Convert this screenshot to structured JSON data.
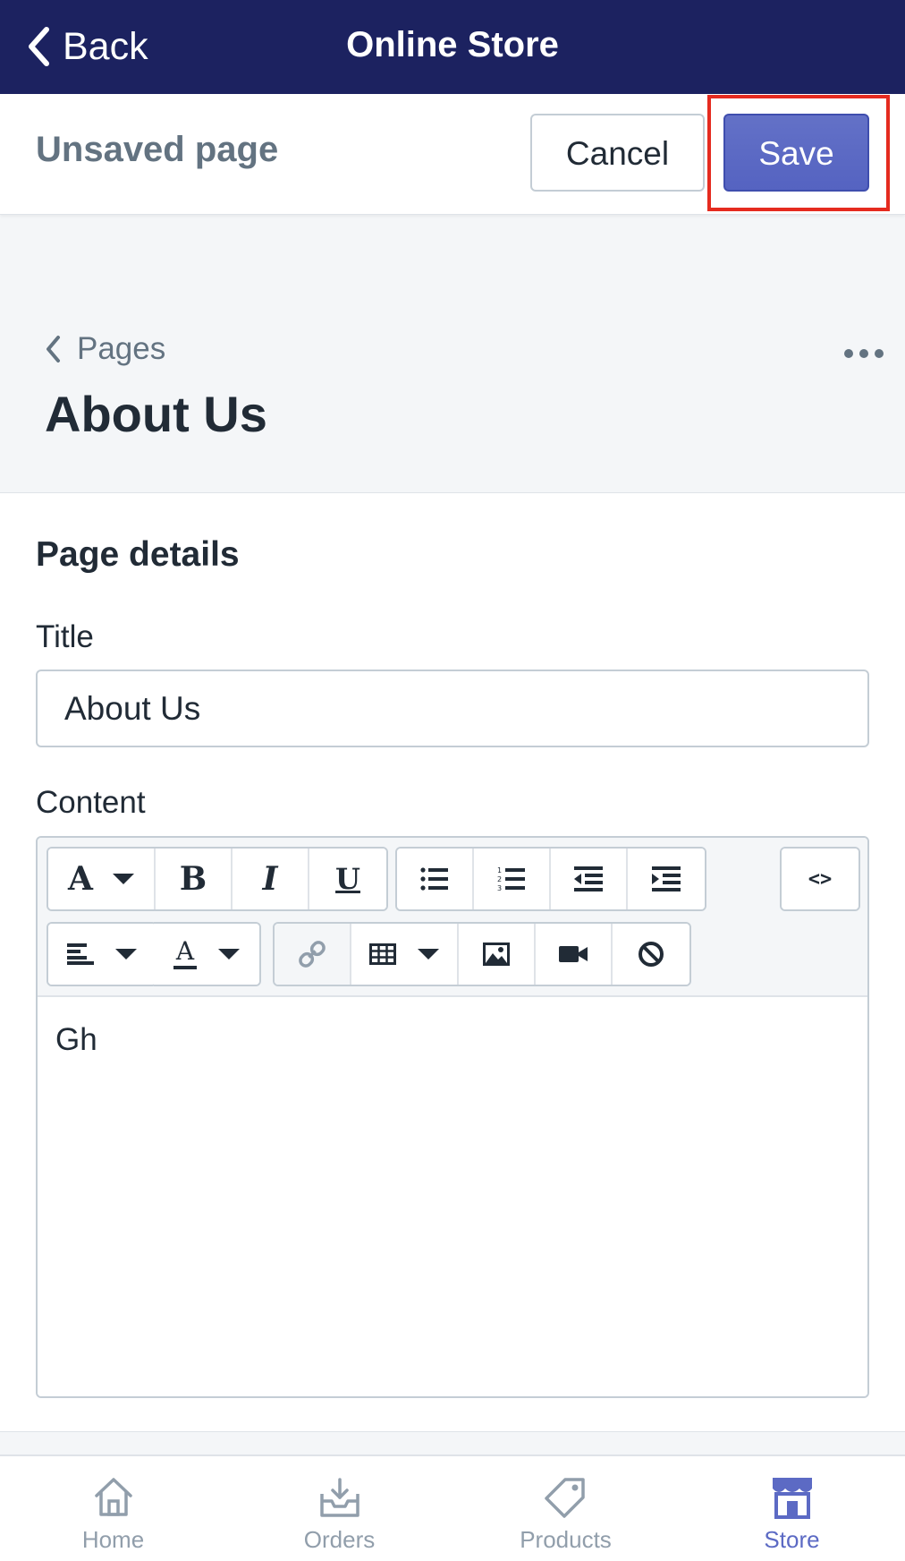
{
  "navbar": {
    "back_label": "Back",
    "title": "Online Store"
  },
  "savebar": {
    "title": "Unsaved page",
    "cancel_label": "Cancel",
    "save_label": "Save"
  },
  "breadcrumb": {
    "label": "Pages"
  },
  "page": {
    "title": "About Us"
  },
  "card": {
    "heading": "Page details",
    "title_label": "Title",
    "title_value": "About Us",
    "content_label": "Content",
    "content_text": "Gh"
  },
  "toolbar": {
    "code_label": "<>"
  },
  "tabbar": {
    "items": [
      {
        "label": "Home",
        "icon": "home-icon"
      },
      {
        "label": "Orders",
        "icon": "orders-icon"
      },
      {
        "label": "Products",
        "icon": "products-icon"
      },
      {
        "label": "Store",
        "icon": "store-icon"
      }
    ],
    "active": "Store"
  },
  "colors": {
    "navbar_bg": "#1c2260",
    "primary": "#5c6ac4",
    "highlight": "#e52b1f",
    "text": "#212b36",
    "muted": "#637381"
  }
}
